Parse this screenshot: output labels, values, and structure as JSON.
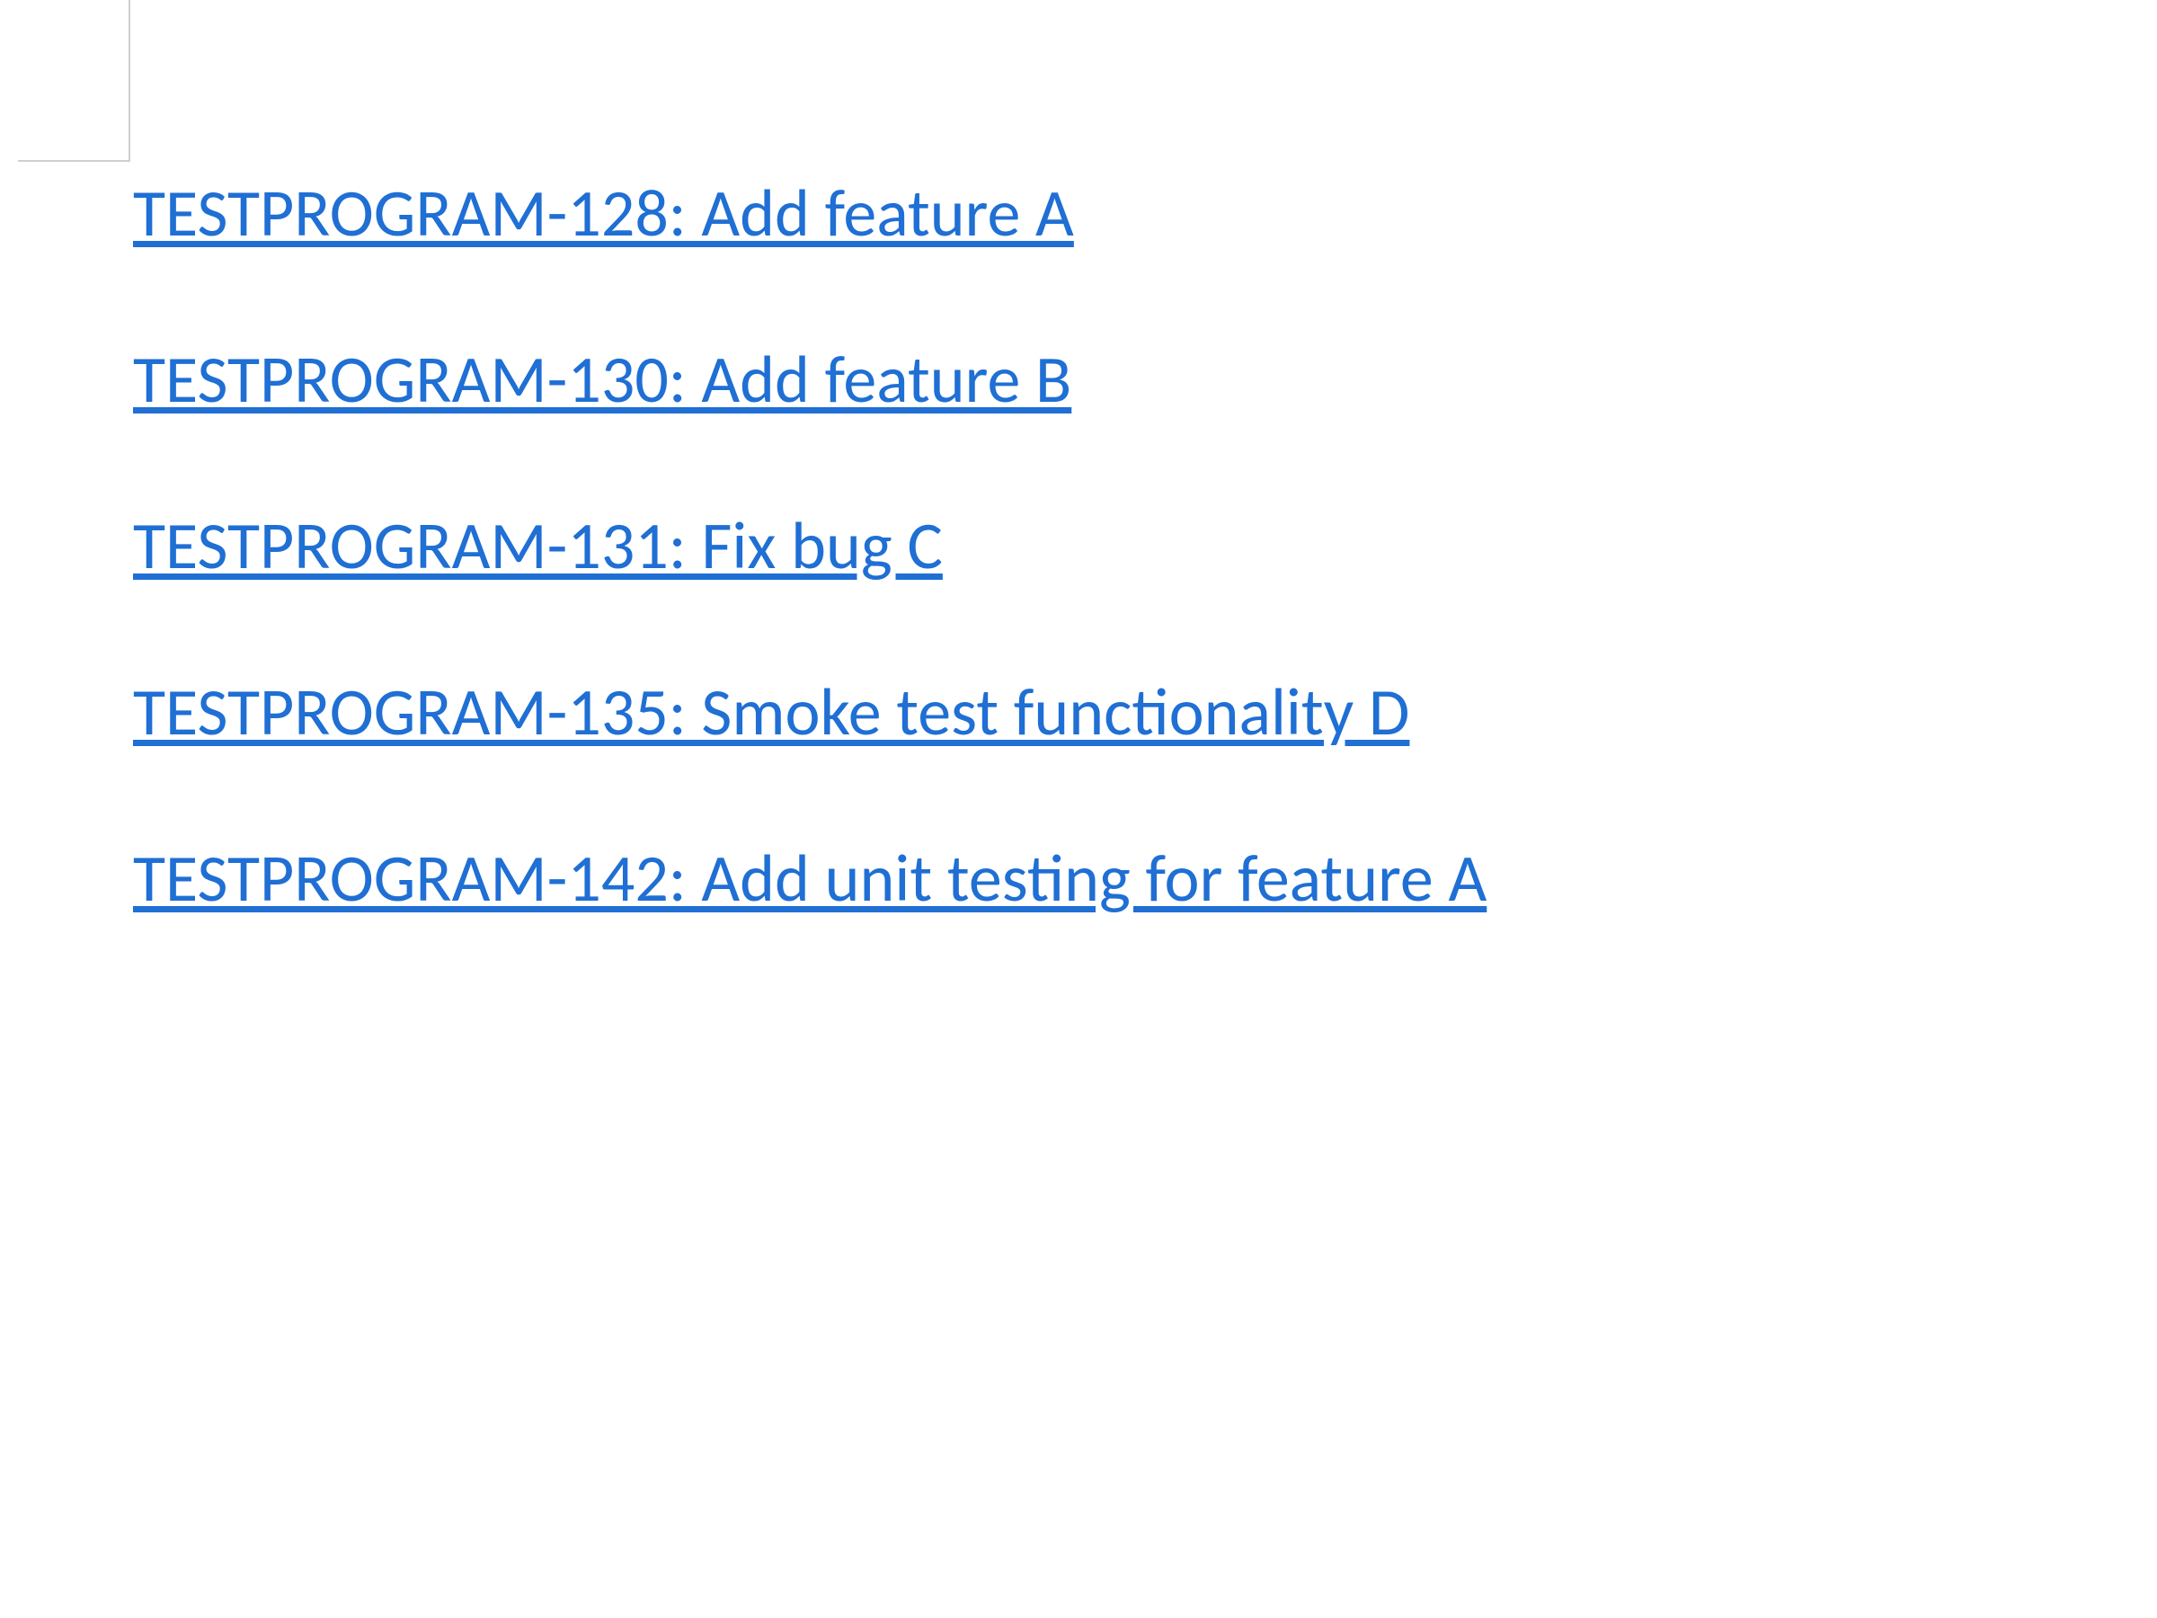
{
  "tickets": [
    {
      "text": "TESTPROGRAM-128: Add feature A"
    },
    {
      "text": "TESTPROGRAM-130: Add feature B"
    },
    {
      "text": "TESTPROGRAM-131: Fix bug C"
    },
    {
      "text": "TESTPROGRAM-135: Smoke test functionality D"
    },
    {
      "text": "TESTPROGRAM-142: Add unit testing for feature A"
    }
  ],
  "colors": {
    "link": "#1f6fd4",
    "border": "#cfcfcf",
    "background": "#ffffff"
  }
}
